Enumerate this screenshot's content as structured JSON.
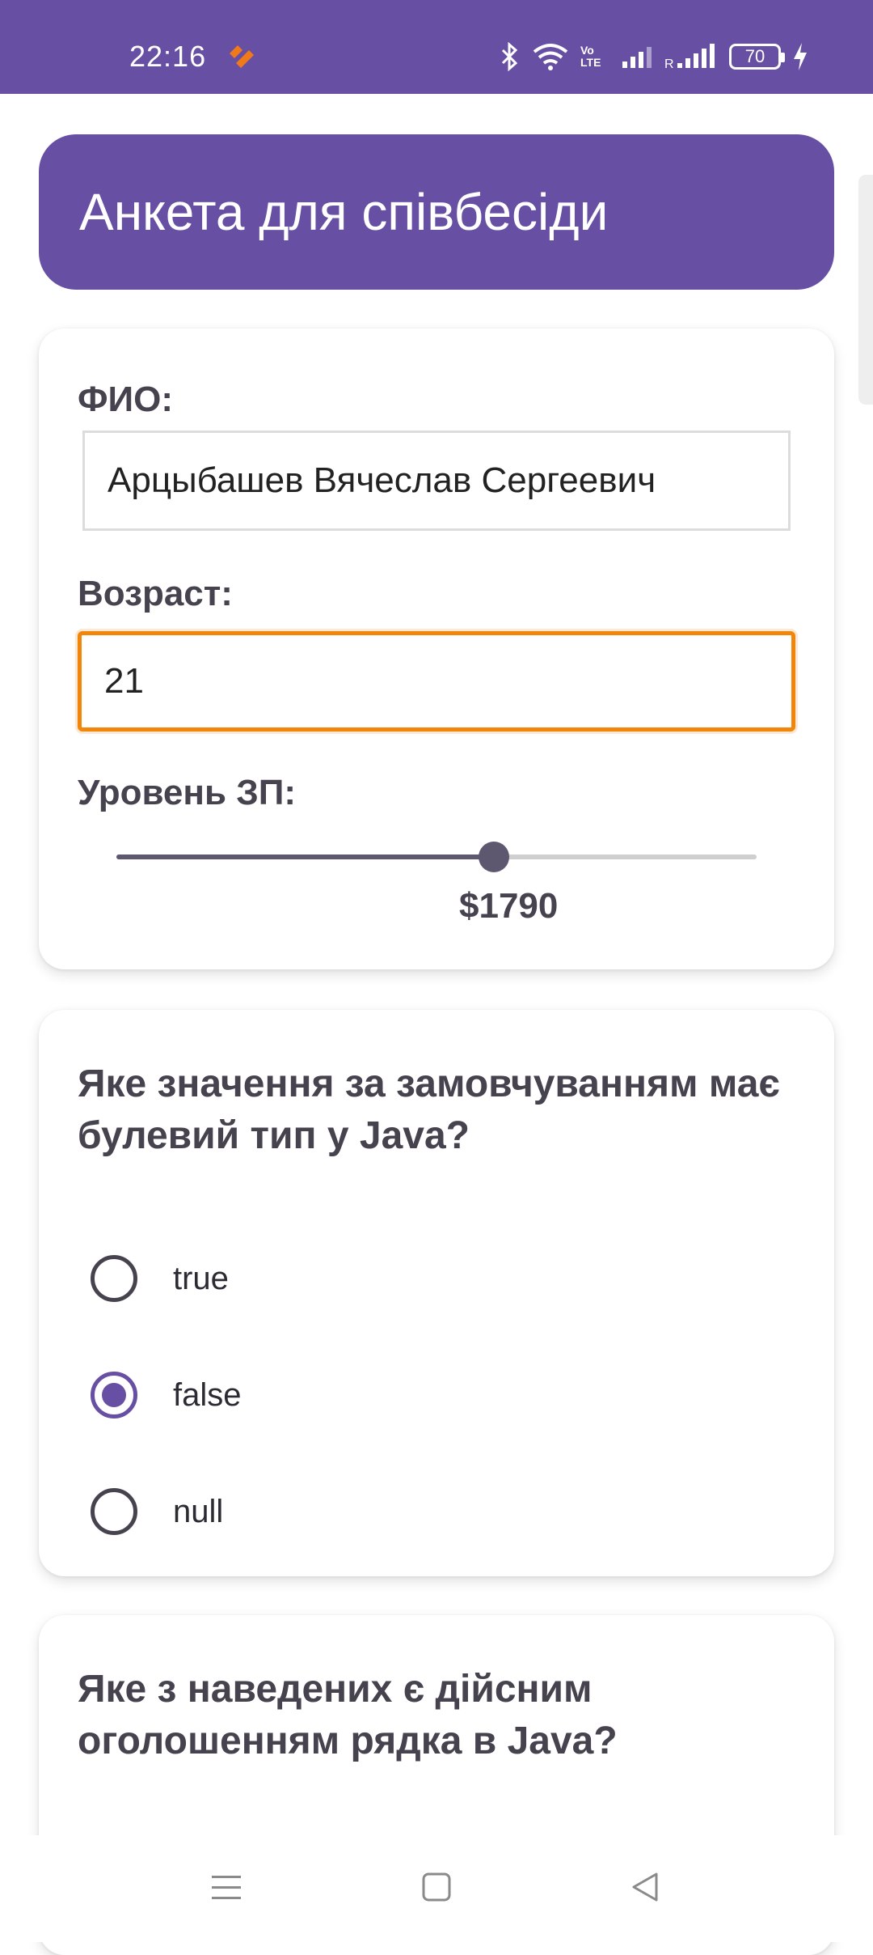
{
  "status_bar": {
    "time": "22:16",
    "network_label": "Vo LTE",
    "battery_level": "70"
  },
  "header": {
    "title": "Анкета для співбесіди"
  },
  "form": {
    "name_label": "ФИО:",
    "name_value": "Арцыбашев Вячеслав Сергеевич",
    "age_label": "Возраст:",
    "age_value": "21",
    "salary_label": "Уровень ЗП:",
    "salary_value_text": "$1790",
    "salary_slider_fraction": 0.59
  },
  "question1": {
    "text": "Яке значення за замовчуванням має булевий тип у Java?",
    "options": [
      {
        "label": "true",
        "selected": false
      },
      {
        "label": "false",
        "selected": true
      },
      {
        "label": "null",
        "selected": false
      }
    ]
  },
  "question2": {
    "text": "Яке з наведених є дійсним оголошенням рядка в Java?"
  },
  "colors": {
    "primary": "#674fa3",
    "focus_border": "#f2860b",
    "app_icon": "#f07a1a"
  }
}
